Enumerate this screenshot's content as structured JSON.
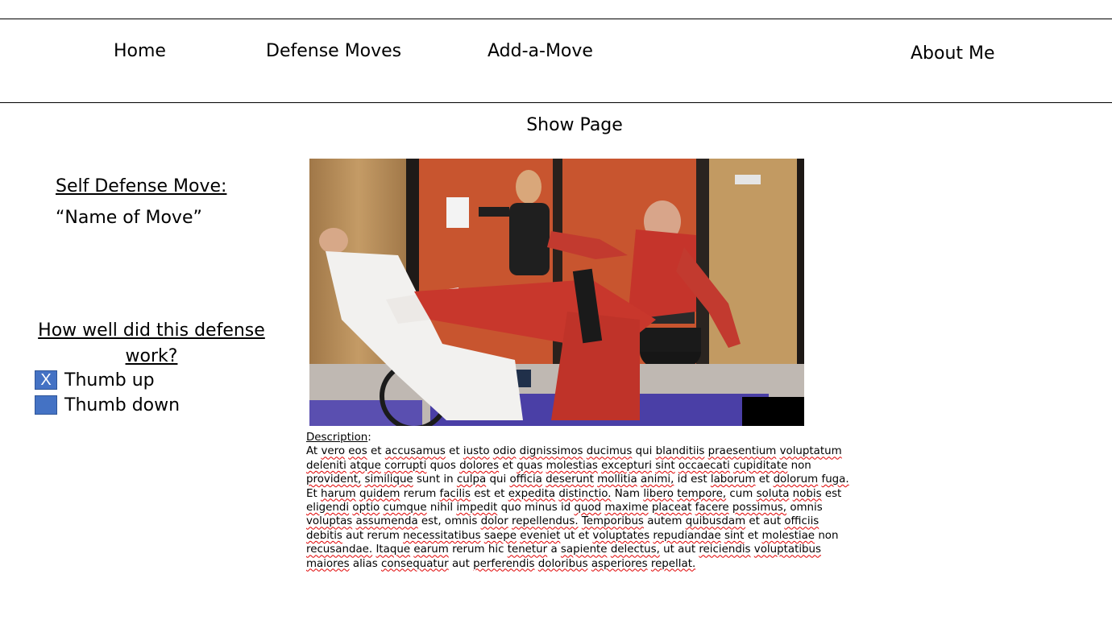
{
  "nav": {
    "home": "Home",
    "defense_moves": "Defense Moves",
    "add_a_move": "Add-a-Move",
    "about_me": "About Me"
  },
  "page_title": "Show Page",
  "move": {
    "heading": "Self Defense Move:",
    "name": "“Name of Move”"
  },
  "rating": {
    "question": "How well did this defense work?",
    "options": [
      {
        "label": "Thumb up",
        "mark": "X",
        "checked": true
      },
      {
        "label": "Thumb down",
        "mark": "",
        "checked": false
      }
    ]
  },
  "video": {
    "progress": 0.875,
    "colors": {
      "progress": "#e50914",
      "checkbox": "#4472c4"
    }
  },
  "description": {
    "label": "Description",
    "text": "At vero eos et accusamus et iusto odio dignissimos ducimus qui blanditiis praesentium voluptatum deleniti atque corrupti quos dolores et quas molestias excepturi sint occaecati cupiditate non provident, similique sunt in culpa qui officia deserunt mollitia animi, id est laborum et dolorum fuga. Et harum quidem rerum facilis est et expedita distinctio. Nam libero tempore, cum soluta nobis est eligendi optio cumque nihil impedit quo minus id quod maxime placeat facere possimus, omnis voluptas assumenda est, omnis dolor repellendus. Temporibus autem quibusdam et aut officiis debitis aut rerum necessitatibus saepe eveniet ut et voluptates repudiandae sint et molestiae non recusandae. Itaque earum rerum hic tenetur a sapiente delectus, ut aut reiciendis voluptatibus maiores alias consequatur aut perferendis doloribus asperiores repellat."
  }
}
